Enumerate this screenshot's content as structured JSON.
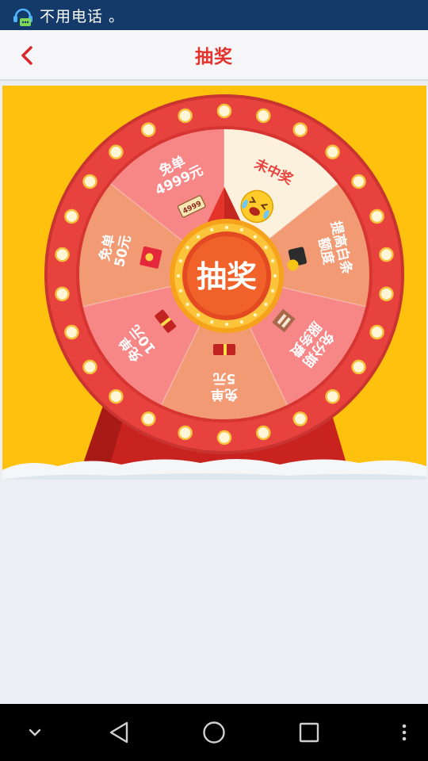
{
  "status_bar": {
    "notification_text": "不用电话 。",
    "notification_icon": "chat-bubble-icon"
  },
  "app_bar": {
    "title": "抽奖",
    "back_icon": "chevron-left-icon"
  },
  "lottery_wheel": {
    "center_button_label": "抽奖",
    "prizes": [
      {
        "label_lines": [
          "未中奖"
        ],
        "icon": "crying-emoji-icon",
        "color": "#fbf1dd"
      },
      {
        "label_lines": [
          "提高白条",
          "额度"
        ],
        "icon": "wallet-icon",
        "color": "#f29a74"
      },
      {
        "label_lines": [
          "免分期",
          "服务费"
        ],
        "icon": "document-icon",
        "color": "#f78686"
      },
      {
        "label_lines": [
          "免单",
          "5元"
        ],
        "icon": "coupon-icon",
        "color": "#f29a74"
      },
      {
        "label_lines": [
          "免单",
          "10元"
        ],
        "icon": "coupon-icon",
        "color": "#f78686"
      },
      {
        "label_lines": [
          "免单",
          "50元"
        ],
        "icon": "red-envelope-icon",
        "color": "#f29a74"
      },
      {
        "label_lines": [
          "免单",
          "4999元"
        ],
        "icon": "ticket-icon",
        "color": "#f78686"
      }
    ],
    "ticket_text": "4999",
    "colors": {
      "background": "#fec20e",
      "rim": "#e8423f",
      "accent_red": "#e4332b"
    }
  },
  "nav_bar": {
    "down_icon": "chevron-down-icon",
    "back_icon": "triangle-back-icon",
    "home_icon": "circle-home-icon",
    "recents_icon": "square-recents-icon",
    "menu_icon": "more-vertical-icon"
  }
}
